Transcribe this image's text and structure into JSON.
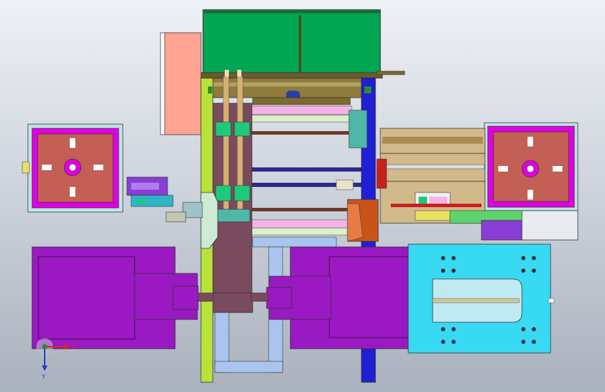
{
  "viewport": {
    "background_top": "#eef1f5",
    "background_bottom": "#a9b1bd"
  },
  "triad": {
    "x_label": "X",
    "y_label": "Y",
    "x_color": "#e0241b",
    "y_color": "#1c8f2a",
    "z_color": "#1f3fb8"
  },
  "colors": {
    "hopper_green": "#00a651",
    "salmon_panel": "#ffa393",
    "magenta": "#e100e6",
    "purple_motor": "#9a19c2",
    "yellow_green_rail": "#b9e23a",
    "blue_rail": "#1f1fd6",
    "plum_frame": "#7a4a5d",
    "tan_table": "#d2b98a",
    "cyan_plate": "#38d9f2",
    "light_blue_duct": "#a9c5ef",
    "orange_block": "#c9541a",
    "pink_strip": "#f6b3e8",
    "rust_plate": "#c35f55",
    "olive_beam": "#7c6a2e"
  }
}
